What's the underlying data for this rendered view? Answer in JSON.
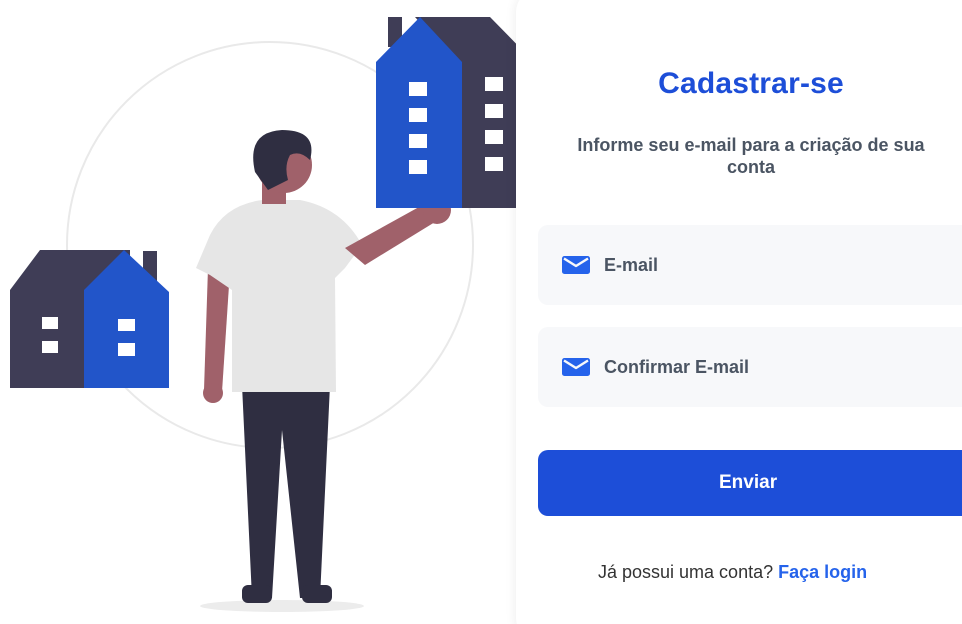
{
  "signup": {
    "title": "Cadastrar-se",
    "subtitle_line1": "Informe seu e-mail para a criação de sua",
    "subtitle_line2": "conta",
    "email_placeholder": "E-mail",
    "confirm_email_placeholder": "Confirmar E-mail",
    "submit_label": "Enviar",
    "footer_text": "Já possui uma conta?",
    "login_link": "Faça login"
  },
  "icons": {
    "field_icon": "mail-icon"
  },
  "colors": {
    "accent": "#1d4ed8",
    "link": "#2563eb",
    "house_blue": "#2255c9",
    "house_dark": "#3f3d56",
    "skin": "#a0616a",
    "shirt": "#e6e6e6",
    "hair": "#2f2e41"
  }
}
